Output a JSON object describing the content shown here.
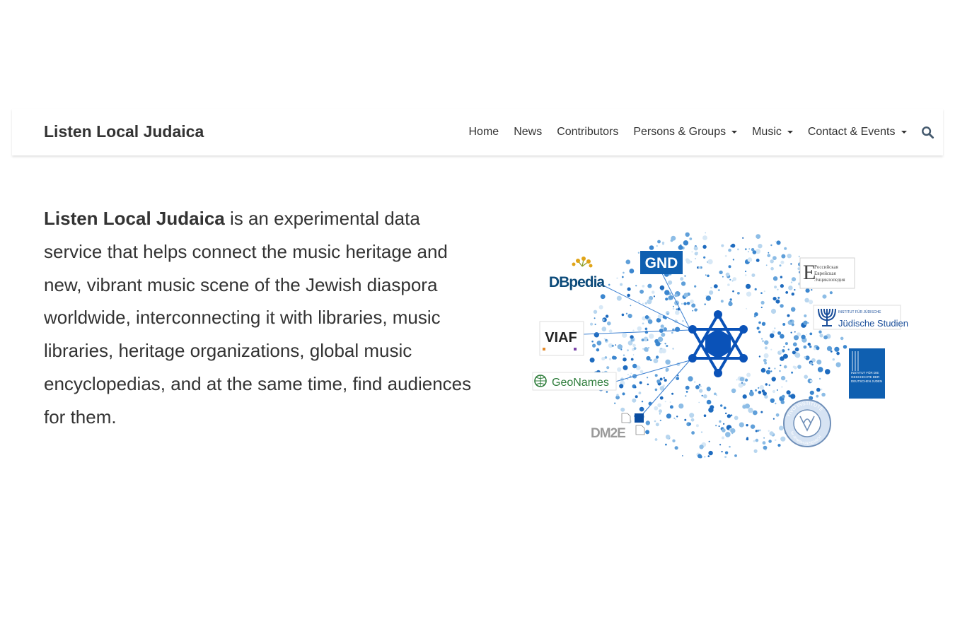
{
  "navbar": {
    "brand": "Listen Local Judaica",
    "items": [
      {
        "label": "Home",
        "dropdown": false
      },
      {
        "label": "News",
        "dropdown": false
      },
      {
        "label": "Contributors",
        "dropdown": false
      },
      {
        "label": "Persons & Groups",
        "dropdown": true
      },
      {
        "label": "Music",
        "dropdown": true
      },
      {
        "label": "Contact & Events",
        "dropdown": true
      }
    ],
    "search_icon": "search-icon"
  },
  "intro": {
    "title": "Listen Local Judaica",
    "text": " is an experimental data service that helps connect the music heritage and new, vibrant music scene of the Jewish diaspora worldwide, interconnecting it with libraries, music libraries, heritage organizations, global music encyclopedias, and at the same time, find audiences for them."
  },
  "network_image": {
    "logos": {
      "dbpedia": "DBpedia",
      "gnd": "GND",
      "viaf": "VIAF",
      "geonames": "GeoNames",
      "dm2e": "DM2E",
      "russian": [
        "Российская",
        "Еврейская",
        "Энциклопедия"
      ],
      "judische_top": "INSTITUT FÜR JÜDISCHE",
      "judische_main": "Jüdische Studien",
      "igdj": [
        "INSTITUT FÜR DIE",
        "GESCHICHTE DER",
        "DEUTSCHEN JUDEN"
      ],
      "yivo": [
        "YIVO INSTITUTE",
        "for JEWISH RESEARCH"
      ]
    },
    "colors": {
      "star": "#0a52b8",
      "gnd_bg": "#0f5fb0",
      "dot": "#4a8fd0",
      "dbpedia": "#0d4b7a",
      "geonames": "#2e7d3b"
    }
  }
}
